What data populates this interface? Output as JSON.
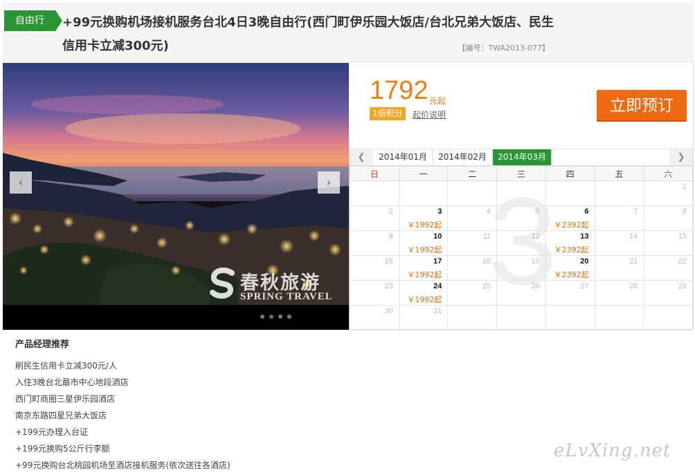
{
  "header": {
    "tag": "自由行",
    "title": "+99元换购机场接机服务台北4日3晚自由行(西门町伊乐园大饭店/台北兄弟大饭店、民生信用卡立减300元)",
    "code": "【编号：TWA2013-077】"
  },
  "photo": {
    "prev_icon": "chevron-left-icon",
    "next_icon": "chevron-right-icon",
    "slide_count": 4,
    "active_slide": 2,
    "watermark_cn": "春秋旅游",
    "watermark_en": "SPRING TRAVEL"
  },
  "price": {
    "amount": "1792",
    "unit": "元起",
    "points": "1倍积分",
    "help": "起价说明",
    "book": "立即预订",
    "accent_color": "#f07d0f"
  },
  "calendar": {
    "months": [
      "2014年01月",
      "2014年02月",
      "2014年03月"
    ],
    "active_month": 2,
    "big_month": "3",
    "weekdays": [
      "日",
      "一",
      "二",
      "三",
      "四",
      "五",
      "六"
    ],
    "weeks": [
      [
        {
          "d": ""
        },
        {
          "d": ""
        },
        {
          "d": ""
        },
        {
          "d": ""
        },
        {
          "d": ""
        },
        {
          "d": ""
        },
        {
          "d": "1"
        }
      ],
      [
        {
          "d": "2"
        },
        {
          "d": "3",
          "p": "￥1992起"
        },
        {
          "d": "4"
        },
        {
          "d": "5"
        },
        {
          "d": "6",
          "p": "￥2392起"
        },
        {
          "d": "7"
        },
        {
          "d": "8"
        }
      ],
      [
        {
          "d": "9"
        },
        {
          "d": "10",
          "p": "￥1992起"
        },
        {
          "d": "11"
        },
        {
          "d": "12"
        },
        {
          "d": "13",
          "p": "￥2392起"
        },
        {
          "d": "14"
        },
        {
          "d": "15"
        }
      ],
      [
        {
          "d": "16"
        },
        {
          "d": "17",
          "p": "￥1992起"
        },
        {
          "d": "18"
        },
        {
          "d": "19"
        },
        {
          "d": "20",
          "p": "￥2392起"
        },
        {
          "d": "21"
        },
        {
          "d": "22"
        }
      ],
      [
        {
          "d": "23"
        },
        {
          "d": "24",
          "p": "￥1992起"
        },
        {
          "d": "25"
        },
        {
          "d": "26"
        },
        {
          "d": "27"
        },
        {
          "d": "28"
        },
        {
          "d": "29"
        }
      ],
      [
        {
          "d": "30"
        },
        {
          "d": "31"
        },
        {
          "d": ""
        },
        {
          "d": ""
        },
        {
          "d": ""
        },
        {
          "d": ""
        },
        {
          "d": ""
        }
      ]
    ]
  },
  "recommend": {
    "title": "产品经理推荐",
    "items": [
      "刷民生信用卡立减300元/人",
      "入住3晚台北最市中心地段酒店",
      "西门町商圈三星伊乐园酒店",
      "南京东路四星兄弟大饭店",
      "+199元办理入台证",
      "+199元换购5公斤行李额",
      "+99元换购台北桃园机场至酒店接机服务(依次送往各酒店)"
    ]
  },
  "site_mark": "eLvXing.net"
}
